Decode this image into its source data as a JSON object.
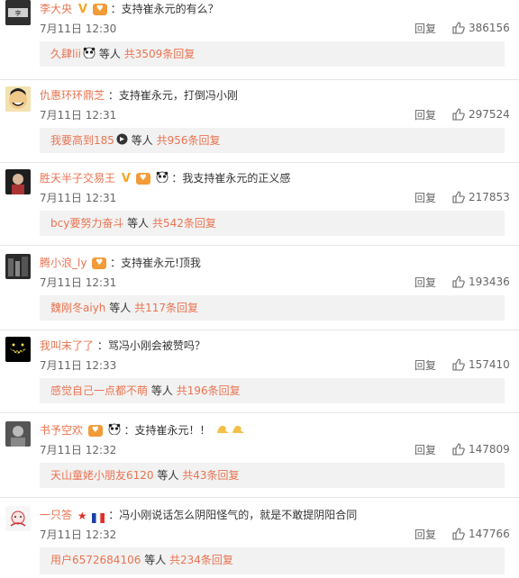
{
  "comments": [
    {
      "name": "李大央",
      "content": "：支持崔永元的有么？",
      "date": "7月11日 12:30",
      "reply_label": "回复",
      "likes": "386156",
      "replies": {
        "names": "久肆lii",
        "sep": "等人",
        "total": "共3509条回复"
      }
    },
    {
      "name": "仇惠环环鼎芝",
      "content": "：支持崔永元，打倒冯小刚",
      "date": "7月11日 12:31",
      "reply_label": "回复",
      "likes": "297524",
      "replies": {
        "names": "我要高到185",
        "sep": "等人",
        "total": "共956条回复"
      }
    },
    {
      "name": "胜天半子交易王",
      "content": "：我支持崔永元的正义感",
      "date": "7月11日 12:31",
      "reply_label": "回复",
      "likes": "217853",
      "replies": {
        "names": "bcy要努力奋斗",
        "sep": "等人",
        "total": "共542条回复"
      }
    },
    {
      "name": "腾小浪_ly",
      "content": "：支持崔永元!顶我",
      "date": "7月11日 12:31",
      "reply_label": "回复",
      "likes": "193436",
      "replies": {
        "names": "魏刚冬aiyh",
        "sep": "等人",
        "total": "共117条回复"
      }
    },
    {
      "name": "我叫末了了",
      "content": "：骂冯小刚会被赞吗？",
      "date": "7月11日 12:33",
      "reply_label": "回复",
      "likes": "157410",
      "replies": {
        "names": "感觉自己一点都不萌",
        "sep": "等人",
        "total": "共196条回复"
      }
    },
    {
      "name": "书予空欢",
      "content": "：支持崔永元！！",
      "date": "7月11日 12:32",
      "reply_label": "回复",
      "likes": "147809",
      "replies": {
        "names": "天山童姥小朋友6120",
        "sep": "等人",
        "total": "共43条回复"
      }
    },
    {
      "name": "一只答",
      "content": "：冯小刚说话怎么阴阳怪气的，就是不敢提阴阳合同",
      "date": "7月11日 12:32",
      "reply_label": "回复",
      "likes": "147766",
      "replies": {
        "names": "用户6572684106",
        "sep": "等人",
        "total": "共234条回复"
      }
    }
  ],
  "icons": {
    "like": "thumbs-up-icon",
    "vip": "v-verified-icon",
    "fan": "fan-badge-icon",
    "panda": "panda-emoji-icon",
    "flex": "flexed-biceps-emoji-icon",
    "flag": "france-flag-icon",
    "star": "red-star-icon"
  },
  "colors": {
    "username": "#eb7350",
    "reply_bg": "#f2f2f2",
    "text": "#333333",
    "meta": "#666666"
  }
}
